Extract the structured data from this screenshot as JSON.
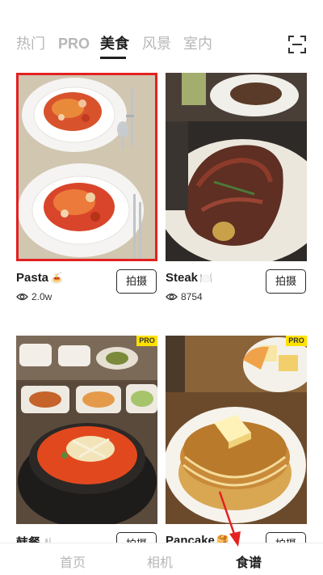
{
  "top_tabs": [
    {
      "label": "热门"
    },
    {
      "label": "PRO"
    },
    {
      "label": "美食"
    },
    {
      "label": "风景"
    },
    {
      "label": "室内"
    }
  ],
  "active_tab": "美食",
  "scan_icon": "scan-frame-icon",
  "cards": [
    {
      "title": "Pasta",
      "emoji": "🍝",
      "views": "2.0w",
      "button": "拍摄",
      "highlighted": true,
      "pro": false
    },
    {
      "title": "Steak",
      "emoji": "🍽️",
      "views": "8754",
      "button": "拍摄",
      "highlighted": false,
      "pro": false
    },
    {
      "title": "韩餐",
      "emoji": "🍴",
      "views": "",
      "button": "拍摄",
      "highlighted": false,
      "pro": true,
      "pro_label": "PRO"
    },
    {
      "title": "Pancake",
      "emoji": "🥞",
      "views": "",
      "button": "拍摄",
      "highlighted": false,
      "pro": true,
      "pro_label": "PRO"
    }
  ],
  "bottom_nav": [
    {
      "label": "首页"
    },
    {
      "label": "相机"
    },
    {
      "label": "食谱"
    }
  ],
  "active_nav": "食谱",
  "colors": {
    "highlight": "#e32121",
    "pro_badge": "#ffe100",
    "text_active": "#1f1f1f",
    "text_inactive": "#b7b7b7"
  }
}
